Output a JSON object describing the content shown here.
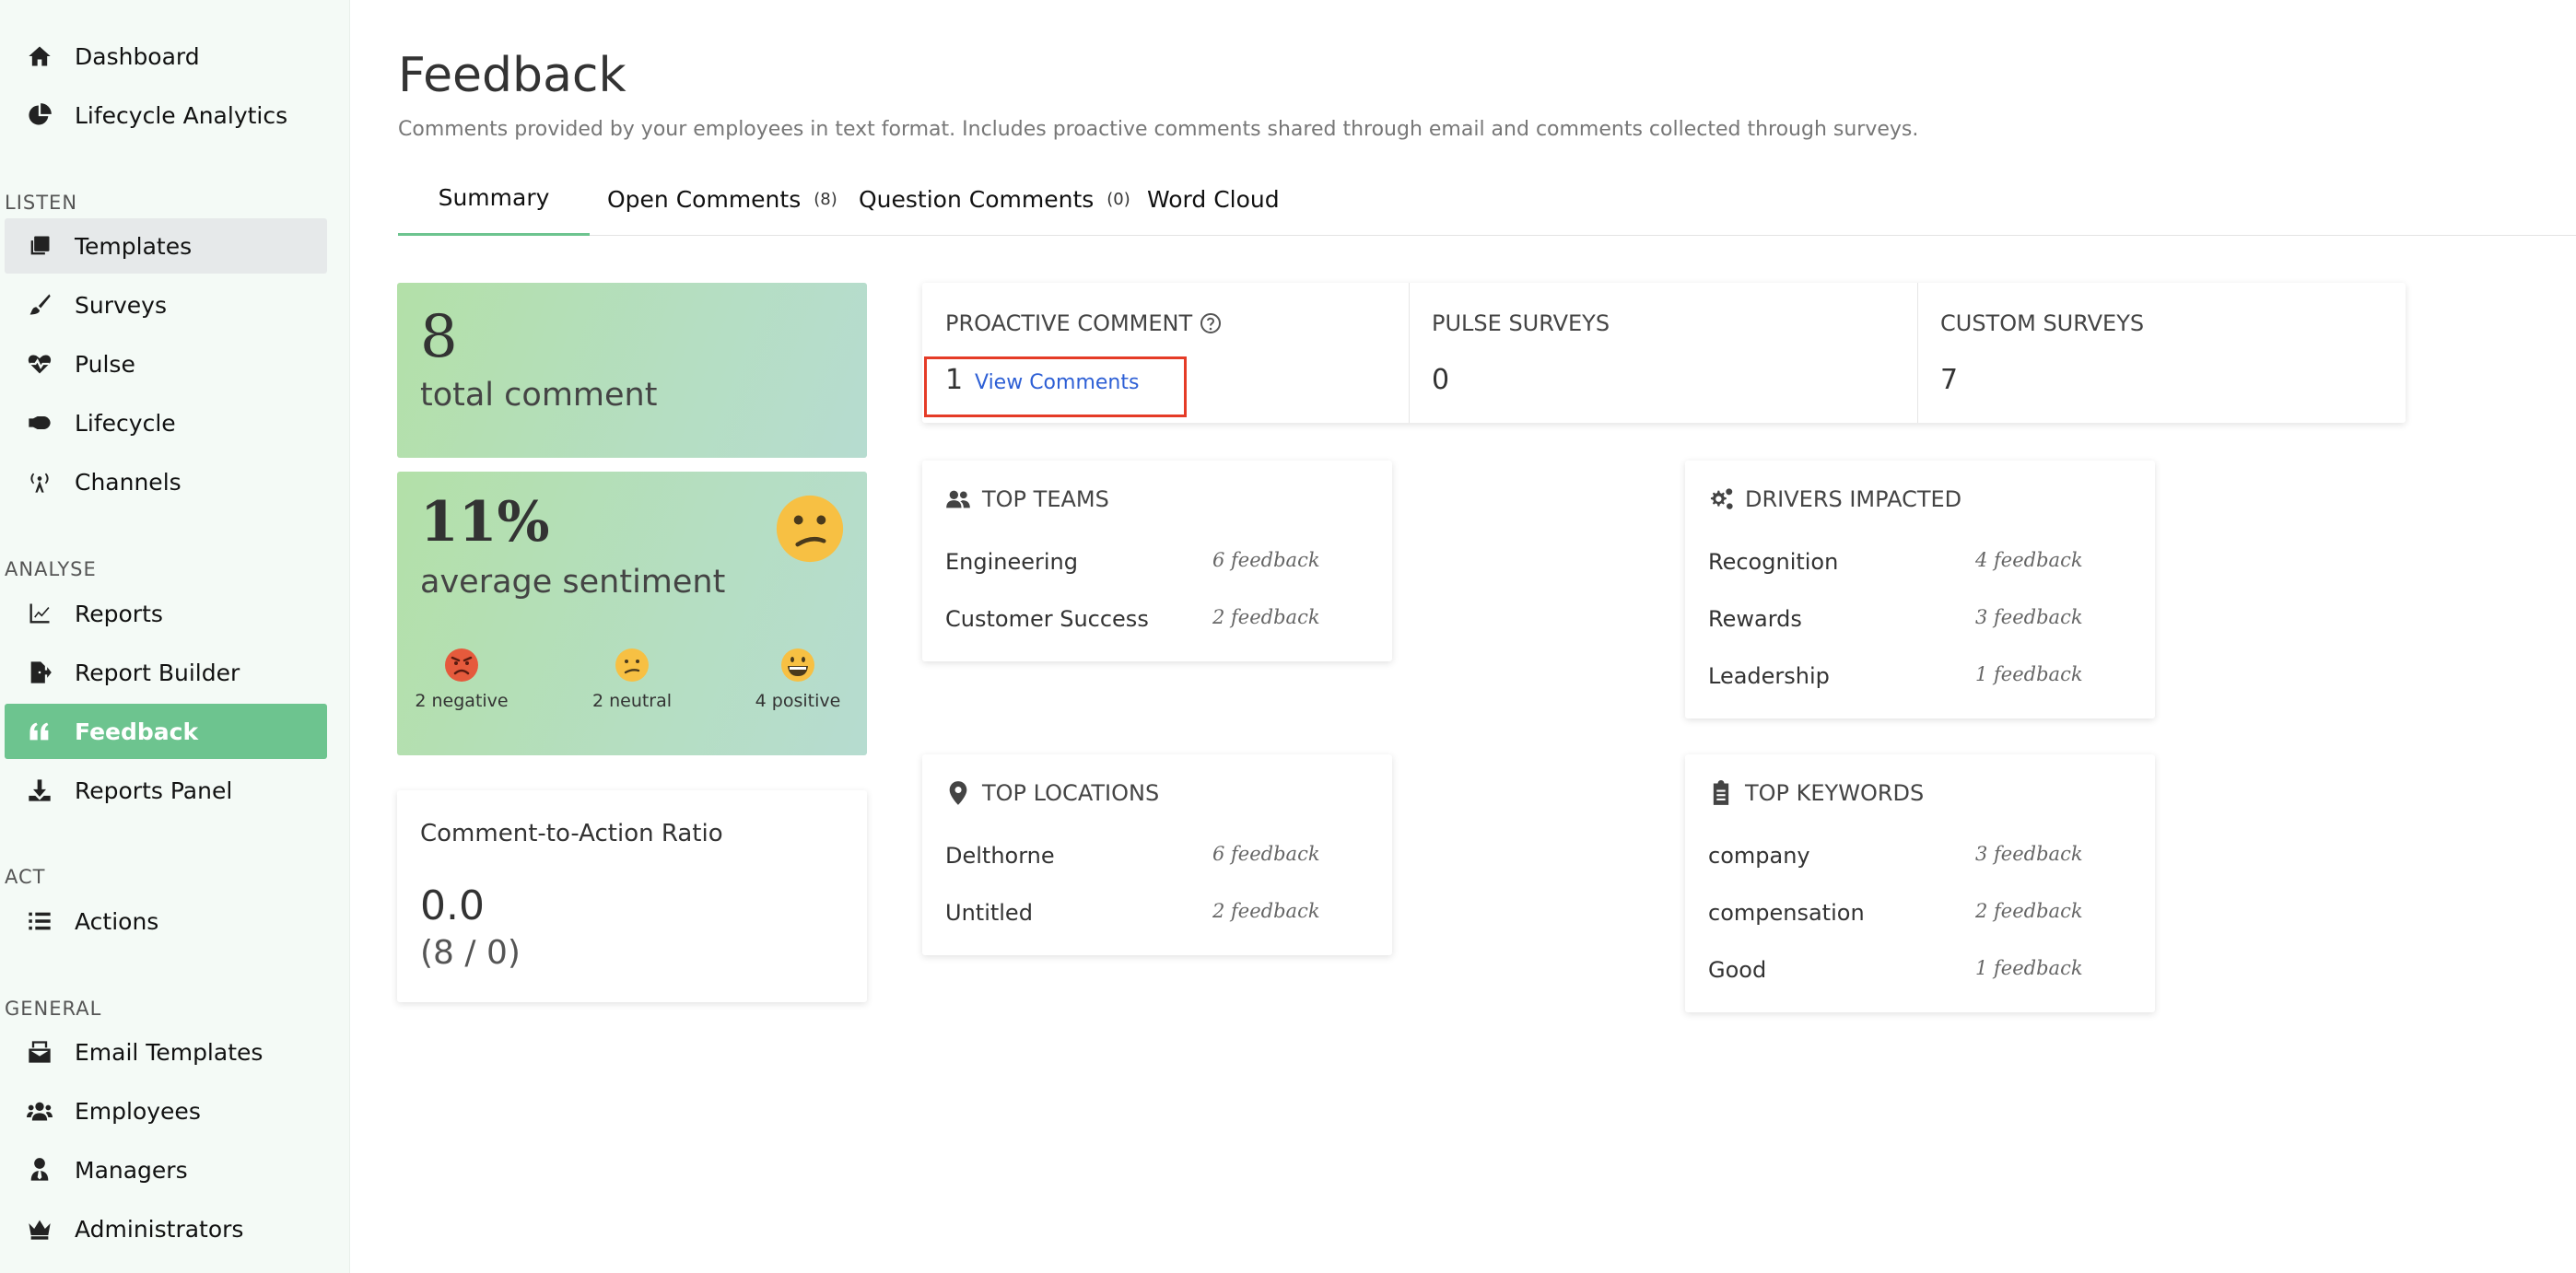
{
  "sidebar": {
    "top_items": [
      {
        "label": "Dashboard",
        "icon": "home-icon"
      },
      {
        "label": "Lifecycle Analytics",
        "icon": "pie-chart-icon"
      }
    ],
    "sections": {
      "listen": "LISTEN",
      "analyse": "ANALYSE",
      "act": "ACT",
      "general": "GENERAL"
    },
    "listen_items": [
      {
        "label": "Templates",
        "icon": "templates-icon"
      },
      {
        "label": "Surveys",
        "icon": "brush-icon"
      },
      {
        "label": "Pulse",
        "icon": "heartbeat-icon"
      },
      {
        "label": "Lifecycle",
        "icon": "lifecycle-icon"
      },
      {
        "label": "Channels",
        "icon": "broadcast-icon"
      }
    ],
    "analyse_items": [
      {
        "label": "Reports",
        "icon": "line-chart-icon"
      },
      {
        "label": "Report Builder",
        "icon": "file-export-icon"
      },
      {
        "label": "Feedback",
        "icon": "quote-icon"
      },
      {
        "label": "Reports Panel",
        "icon": "download-icon"
      }
    ],
    "act_items": [
      {
        "label": "Actions",
        "icon": "list-icon"
      }
    ],
    "general_items": [
      {
        "label": "Email Templates",
        "icon": "mail-bulk-icon"
      },
      {
        "label": "Employees",
        "icon": "users-icon"
      },
      {
        "label": "Managers",
        "icon": "user-tie-icon"
      },
      {
        "label": "Administrators",
        "icon": "crown-icon"
      }
    ]
  },
  "page": {
    "title": "Feedback",
    "subtitle": "Comments provided by your employees in text format. Includes proactive comments shared through email and comments collected through surveys."
  },
  "tabs": [
    {
      "label": "Summary",
      "count": ""
    },
    {
      "label": "Open Comments",
      "count": "(8)"
    },
    {
      "label": "Question Comments",
      "count": "(0)"
    },
    {
      "label": "Word Cloud",
      "count": ""
    }
  ],
  "total": {
    "value": "8",
    "label": "total comment"
  },
  "sentiment": {
    "value": "11%",
    "label": "average sentiment",
    "negative": "2 negative",
    "neutral": "2 neutral",
    "positive": "4 positive"
  },
  "ratio": {
    "title": "Comment-to-Action Ratio",
    "value": "0.0",
    "detail": "(8 / 0)"
  },
  "stats": {
    "proactive": {
      "label": "PROACTIVE COMMENT",
      "value": "1",
      "link": "View Comments"
    },
    "pulse": {
      "label": "PULSE SURVEYS",
      "value": "0"
    },
    "custom": {
      "label": "CUSTOM SURVEYS",
      "value": "7"
    }
  },
  "top_teams": {
    "title": "TOP TEAMS",
    "rows": [
      {
        "name": "Engineering",
        "count": "6 feedback"
      },
      {
        "name": "Customer Success",
        "count": "2 feedback"
      }
    ]
  },
  "drivers": {
    "title": "DRIVERS IMPACTED",
    "rows": [
      {
        "name": "Recognition",
        "count": "4 feedback"
      },
      {
        "name": "Rewards",
        "count": "3 feedback"
      },
      {
        "name": "Leadership",
        "count": "1 feedback"
      }
    ]
  },
  "top_locations": {
    "title": "TOP LOCATIONS",
    "rows": [
      {
        "name": "Delthorne",
        "count": "6 feedback"
      },
      {
        "name": "Untitled",
        "count": "2 feedback"
      }
    ]
  },
  "top_keywords": {
    "title": "TOP KEYWORDS",
    "rows": [
      {
        "name": "company",
        "count": "3 feedback"
      },
      {
        "name": "compensation",
        "count": "2 feedback"
      },
      {
        "name": "Good",
        "count": "1 feedback"
      }
    ]
  },
  "colors": {
    "accent": "#6dc48f",
    "highlight": "#e53b27",
    "link": "#2d5fd5"
  }
}
